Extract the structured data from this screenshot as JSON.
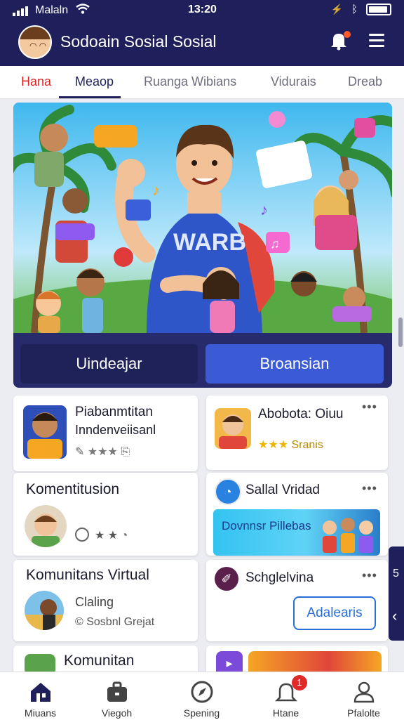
{
  "status_bar": {
    "carrier": "Malaln",
    "time": "13:20",
    "wifi_icon": "wifi-icon",
    "bluetooth_icon": "bluetooth-icon",
    "battery_icon": "battery-icon"
  },
  "header": {
    "title": "Sodoain Sosial Sosial",
    "avatar_icon": "user-avatar",
    "bell_icon": "bell-icon",
    "menu_icon": "hamburger-menu-icon"
  },
  "tabs": [
    {
      "label": "Hana"
    },
    {
      "label": "Meaop"
    },
    {
      "label": "Ruanga Wibians"
    },
    {
      "label": "Vidurais"
    },
    {
      "label": "Dreab"
    }
  ],
  "hero": {
    "shirt_text": "WARB",
    "left_button": "Uindeajar",
    "right_button": "Broansian"
  },
  "cards": {
    "c1": {
      "title": "Piabanmtitan",
      "subtitle": "Inndenveiisanl",
      "meta": "★★★"
    },
    "c2": {
      "title": "Abobota: Oiuu",
      "meta": "Sranis",
      "more": "•••"
    },
    "c3": {
      "title": "Komentitusion",
      "meta": "★ ★"
    },
    "c4": {
      "title": "Sallal Vridad",
      "banner": "Dovnnsr Pillebas",
      "more": "•••"
    },
    "c5": {
      "title": "Komunitans Virtual",
      "subtitle": "Claling",
      "meta": "Sosbnl Grejat"
    },
    "c6": {
      "title": "Schglelvina",
      "button": "Adalearis",
      "more": "•••"
    },
    "c7": {
      "title": "Komunitan"
    }
  },
  "side_tab": {
    "top": "5",
    "chevron": "‹"
  },
  "bottom_nav": [
    {
      "label": "Miuans",
      "icon": "home-icon"
    },
    {
      "label": "Viegoh",
      "icon": "briefcase-icon"
    },
    {
      "label": "Spening",
      "icon": "compass-icon"
    },
    {
      "label": "Htane",
      "icon": "bell-icon",
      "badge": "1"
    },
    {
      "label": "Pfalolte",
      "icon": "person-icon"
    }
  ],
  "colors": {
    "primary": "#1f1f5c",
    "accent_blue": "#3b5ad6",
    "active_tab": "#d22222",
    "star": "#f0b400"
  }
}
